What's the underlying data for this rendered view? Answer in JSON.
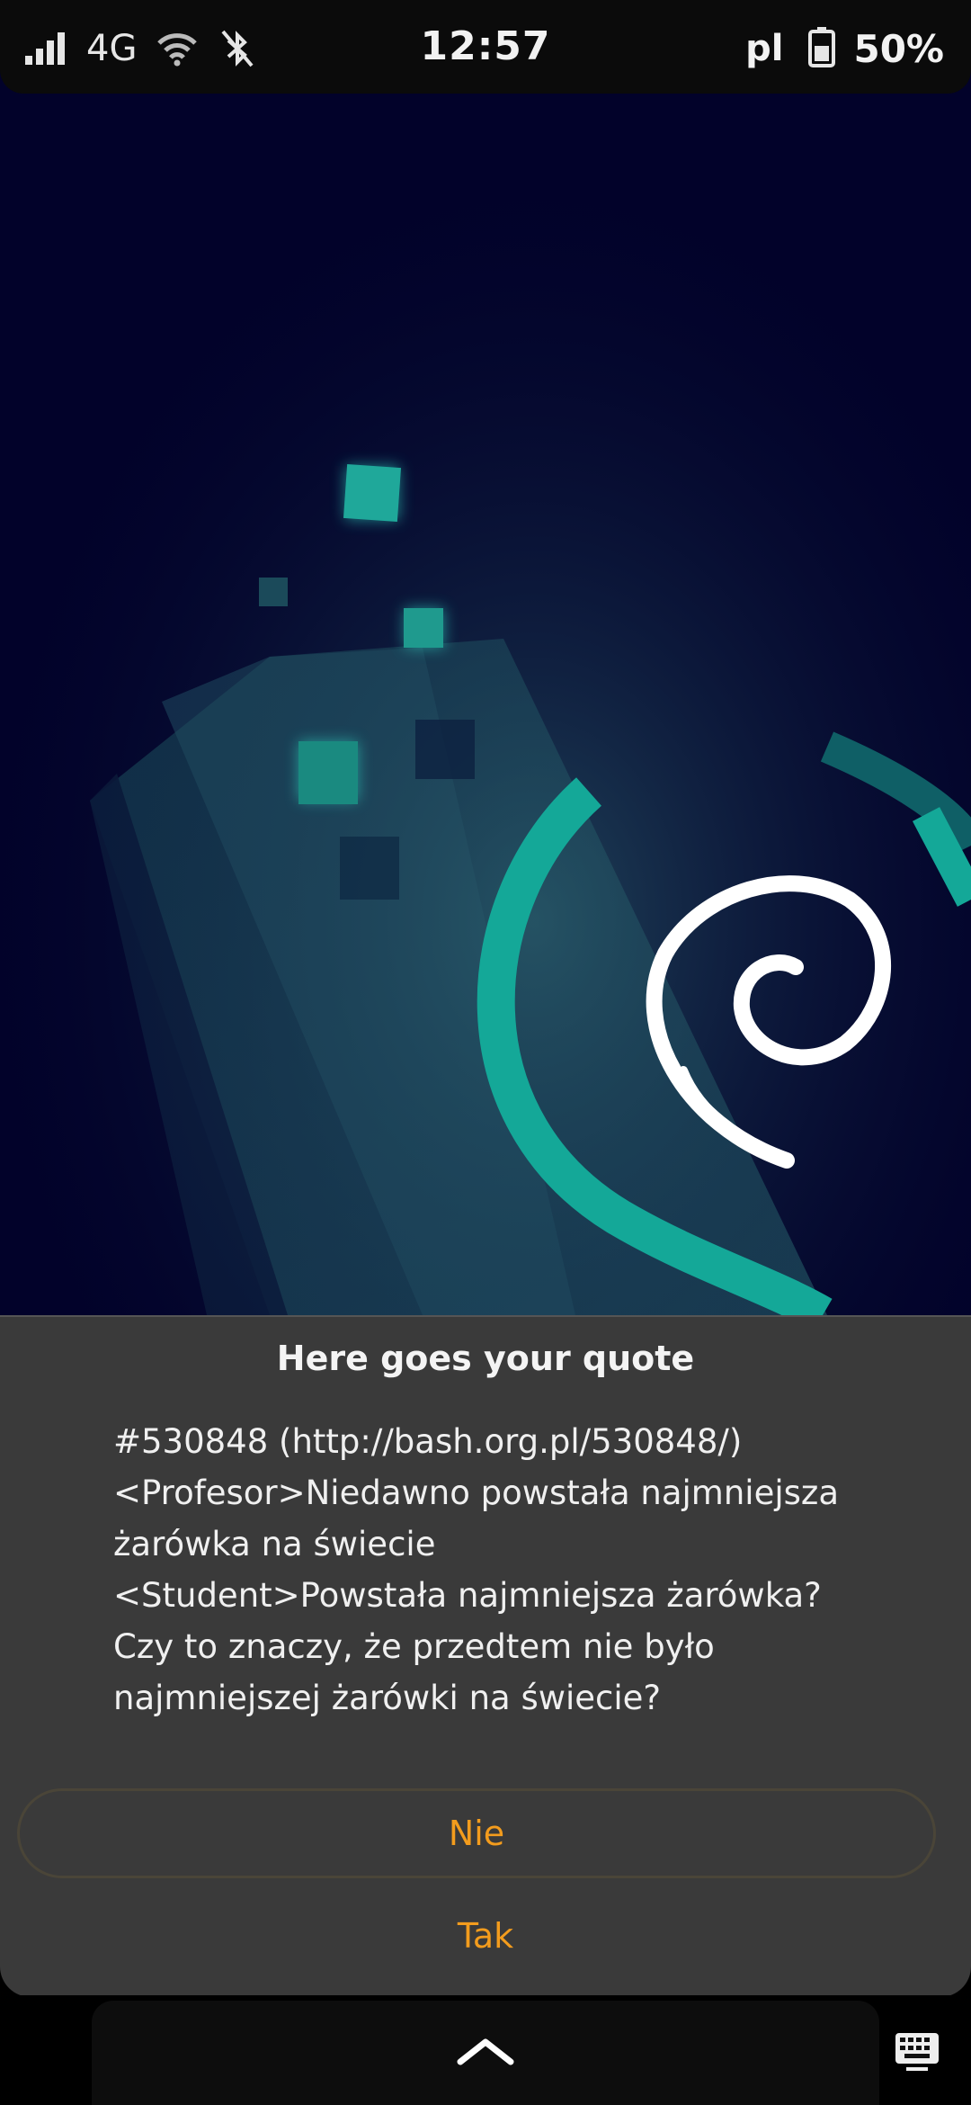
{
  "status_bar": {
    "network_type": "4G",
    "time": "12:57",
    "language": "pl",
    "battery": "50%"
  },
  "dialog": {
    "title": "Here goes your quote",
    "body": "#530848 (http://bash.org.pl/530848/)\n<Profesor>Niedawno powstała najmniejsza żarówka na świecie\n<Student>Powstała najmniejsza żarówka? Czy to znaczy, że przedtem nie było najmniejszej żarówki na świecie?",
    "button_no": "Nie",
    "button_yes": "Tak",
    "accent_color": "#f39c1d"
  },
  "icons": [
    "signal-icon",
    "wifi-icon",
    "bluetooth-off-icon",
    "battery-icon",
    "chevron-up-icon",
    "keyboard-icon",
    "debian-swirl-logo"
  ]
}
